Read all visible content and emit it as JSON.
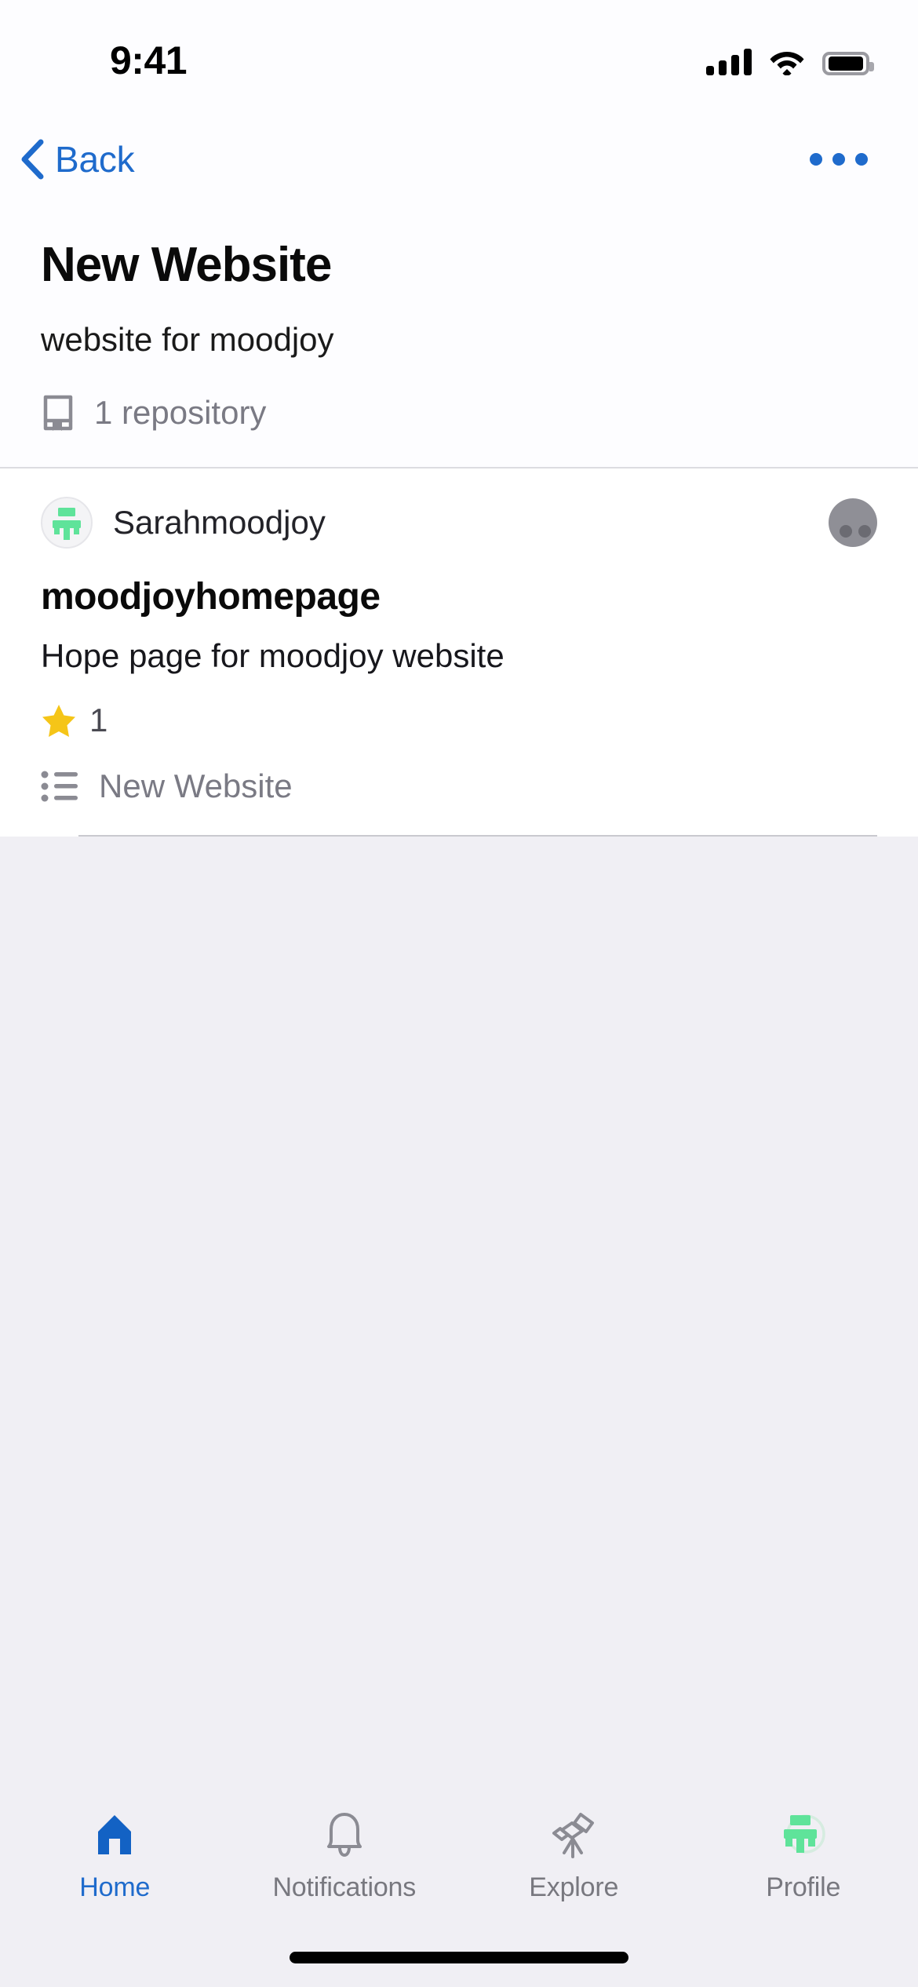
{
  "status_bar": {
    "time": "9:41",
    "signal_icon": "cellular-bars-icon",
    "wifi_icon": "wifi-icon",
    "battery_icon": "battery-full-icon"
  },
  "nav": {
    "back_label": "Back",
    "back_icon": "chevron-left-icon",
    "more_icon": "more-horizontal-icon"
  },
  "header": {
    "title": "New Website",
    "description": "website for moodjoy",
    "repo_icon": "repository-icon",
    "repo_count_label": "1 repository"
  },
  "repository": {
    "owner": "Sarahmoodjoy",
    "owner_avatar_icon": "moodjoy-logo-avatar",
    "member_avatar_icon": "user-avatar-placeholder",
    "name": "moodjoyhomepage",
    "description": "Hope page for moodjoy website",
    "star_icon": "star-icon",
    "star_count": "1",
    "list_icon": "unordered-list-icon",
    "list_label": "New Website"
  },
  "tabbar": {
    "items": [
      {
        "label": "Home",
        "icon": "home-icon",
        "active": true
      },
      {
        "label": "Notifications",
        "icon": "bell-icon",
        "active": false
      },
      {
        "label": "Explore",
        "icon": "telescope-icon",
        "active": false
      },
      {
        "label": "Profile",
        "icon": "profile-avatar-icon",
        "active": false
      }
    ]
  },
  "colors": {
    "accent_blue": "#1f6bcc",
    "brand_green": "#5fe39a",
    "star_yellow": "#f5c518",
    "page_background": "#f0eff4",
    "card_background": "#ffffff",
    "muted_text": "#7a7a84"
  }
}
